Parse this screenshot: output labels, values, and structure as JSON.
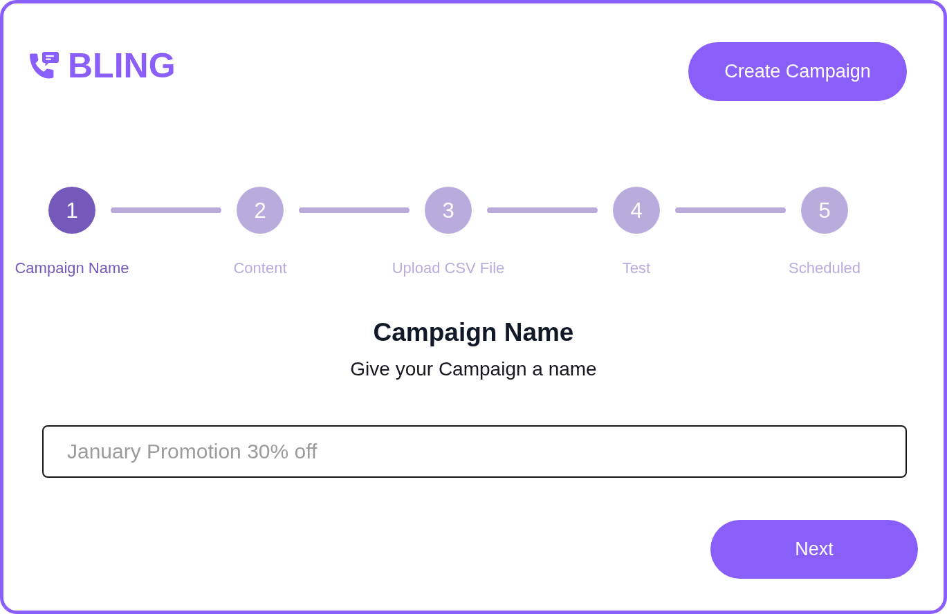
{
  "brand": {
    "name": "BLING"
  },
  "header": {
    "create_button": "Create Campaign"
  },
  "steps": [
    {
      "number": "1",
      "label": "Campaign Name",
      "selected": true
    },
    {
      "number": "2",
      "label": "Content",
      "selected": false
    },
    {
      "number": "3",
      "label": "Upload CSV File",
      "selected": false
    },
    {
      "number": "4",
      "label": "Test",
      "selected": false
    },
    {
      "number": "5",
      "label": "Scheduled",
      "selected": false
    }
  ],
  "section": {
    "title": "Campaign Name",
    "subtitle": "Give your Campaign a name"
  },
  "name_field": {
    "placeholder": "January Promotion 30% off"
  },
  "next_button": "Next"
}
